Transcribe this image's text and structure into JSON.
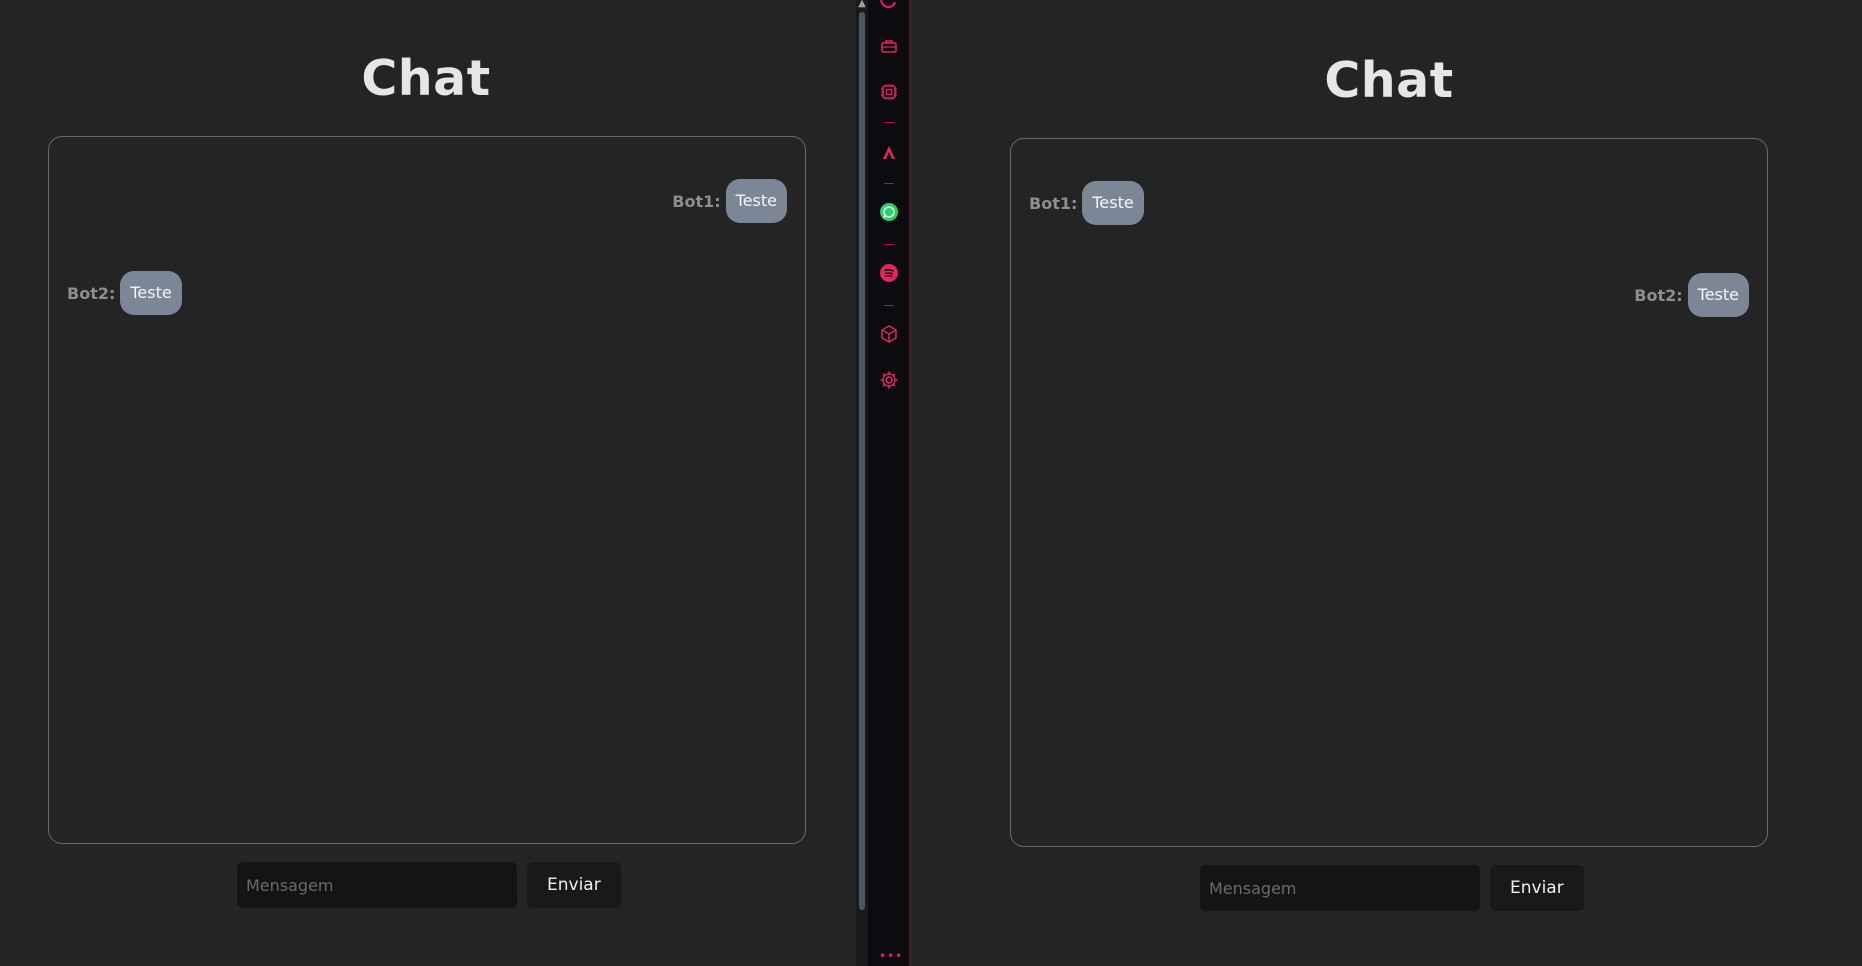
{
  "colors": {
    "background": "#242424",
    "bubble": "#7b8796",
    "dock_accent": "#e0245e",
    "whatsapp": "#25d366"
  },
  "panes": [
    {
      "title": "Chat",
      "messages": [
        {
          "sender": "Bot1:",
          "text": "Teste",
          "align": "right"
        },
        {
          "sender": "Bot2:",
          "text": "Teste",
          "align": "left"
        }
      ],
      "input_placeholder": "Mensagem",
      "send_label": "Enviar"
    },
    {
      "title": "Chat",
      "messages": [
        {
          "sender": "Bot1:",
          "text": "Teste",
          "align": "left"
        },
        {
          "sender": "Bot2:",
          "text": "Teste",
          "align": "right"
        }
      ],
      "input_placeholder": "Mensagem",
      "send_label": "Enviar"
    }
  ],
  "dock": {
    "icons": [
      "refresh-icon",
      "briefcase-icon",
      "chip-icon",
      "anthropic-icon",
      "whatsapp-icon",
      "spotify-icon",
      "cube-icon",
      "settings-icon"
    ],
    "more_glyph": "•••"
  }
}
